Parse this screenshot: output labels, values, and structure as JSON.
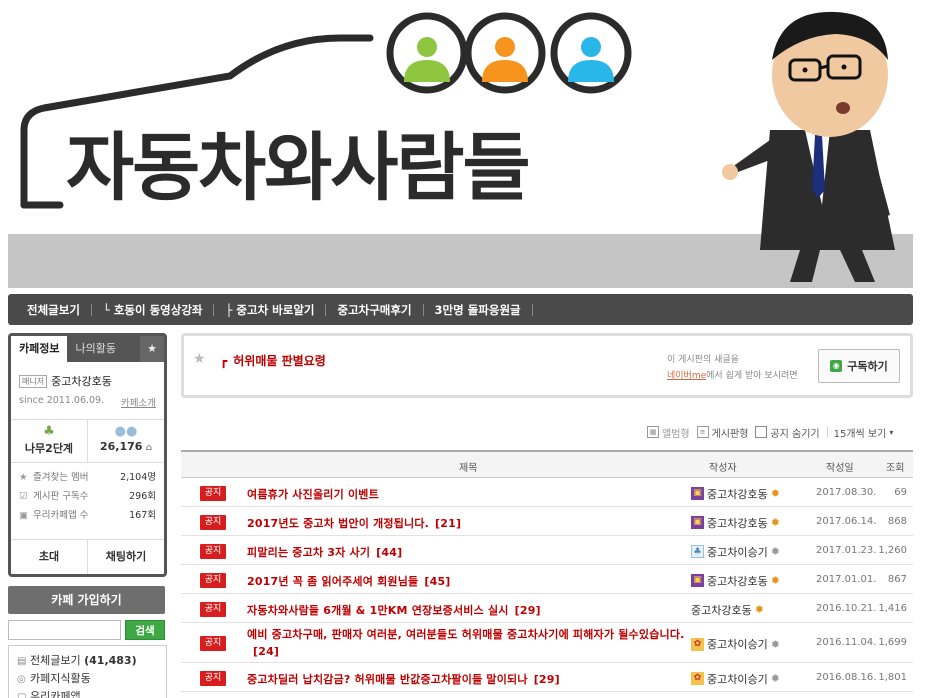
{
  "banner": {
    "title": "자동차와사람들"
  },
  "top_menu": [
    {
      "label": "전체글보기"
    },
    {
      "label": "└ 호동이 동영상강좌"
    },
    {
      "label": "├ 중고차 바로알기"
    },
    {
      "label": "중고차구매후기"
    },
    {
      "label": "3만명 돌파응원글"
    }
  ],
  "cafe": {
    "tab_info": "카페정보",
    "tab_activity": "나의활동",
    "tab_star": "★",
    "manager_badge": "매니저",
    "manager_name": "중고차강호동",
    "since": "since 2011.06.09.",
    "intro_link": "카페소개",
    "level": "나무2단계",
    "members": "26,176",
    "stats": [
      {
        "label": "즐겨찾는 멤버",
        "value": "2,104명",
        "icon": "star-icon"
      },
      {
        "label": "게시판 구독수",
        "value": "296회",
        "icon": "check-icon"
      },
      {
        "label": "우리카페앱 수",
        "value": "167회",
        "icon": "phone-icon"
      }
    ],
    "invite": "초대",
    "chat": "채팅하기",
    "join": "카페 가입하기",
    "search_placeholder": "",
    "search_button": "검색"
  },
  "side_menu": {
    "all_posts_label": "전체글보기",
    "all_posts_count": "(41,483)",
    "knowledge_label": "카페지식활동",
    "app_label": "우리카페앱"
  },
  "board": {
    "title": "허위매물 판별요령",
    "sub_line1": "이 게시판의 새글을",
    "sub_link": "네이버me",
    "sub_line2": "에서 쉽게 받아 보시려면",
    "subscribe": "구독하기",
    "view_album": "앨범형",
    "view_board": "게시판형",
    "hide_notice": "공지 숨기기",
    "per_page": "15개씩 보기"
  },
  "table": {
    "headers": {
      "subject": "제목",
      "author": "작성자",
      "date": "작성일",
      "views": "조회"
    },
    "notice_label": "공지",
    "rows": [
      {
        "subject": "여름휴가 사진올리기 이벤트",
        "comments": "",
        "author": "중고차강호동",
        "level": "purple",
        "date": "2017.08.30.",
        "views": "69",
        "lines": 1
      },
      {
        "subject": "2017년도 중고차 법안이 개정됩니다.",
        "comments": "[21]",
        "author": "중고차강호동",
        "level": "purple",
        "date": "2017.06.14.",
        "views": "868",
        "lines": 1
      },
      {
        "subject": "피말리는 중고차 3자 사기",
        "comments": "[44]",
        "author": "중고차이승기",
        "level": "tree",
        "date": "2017.01.23.",
        "views": "1,260",
        "lines": 1
      },
      {
        "subject": "2017년 꼭 좀 읽어주세여 회원님들",
        "comments": "[45]",
        "author": "중고차강호동",
        "level": "purple",
        "date": "2017.01.01.",
        "views": "867",
        "lines": 1
      },
      {
        "subject": "자동차와사람들 6개월 & 1만KM 연장보증서비스 실시",
        "comments": "[29]",
        "author": "중고차강호동",
        "level": "none",
        "date": "2016.10.21.",
        "views": "1,416",
        "lines": 1
      },
      {
        "subject": "예비 중고차구매, 판매자 여러분, 여러분들도 허위매물 중고차사기에 피해자가 될수있습니다.",
        "comments": "[24]",
        "author": "중고차이승기",
        "level": "colorful",
        "date": "2016.11.04.",
        "views": "1,699",
        "lines": 2
      },
      {
        "subject": "중고차딜러 납치감금? 허위매물 반값중고차팔이들 말이되나",
        "comments": "[29]",
        "author": "중고차이승기",
        "level": "colorful",
        "date": "2016.08.16.",
        "views": "1,801",
        "lines": 1
      }
    ]
  }
}
